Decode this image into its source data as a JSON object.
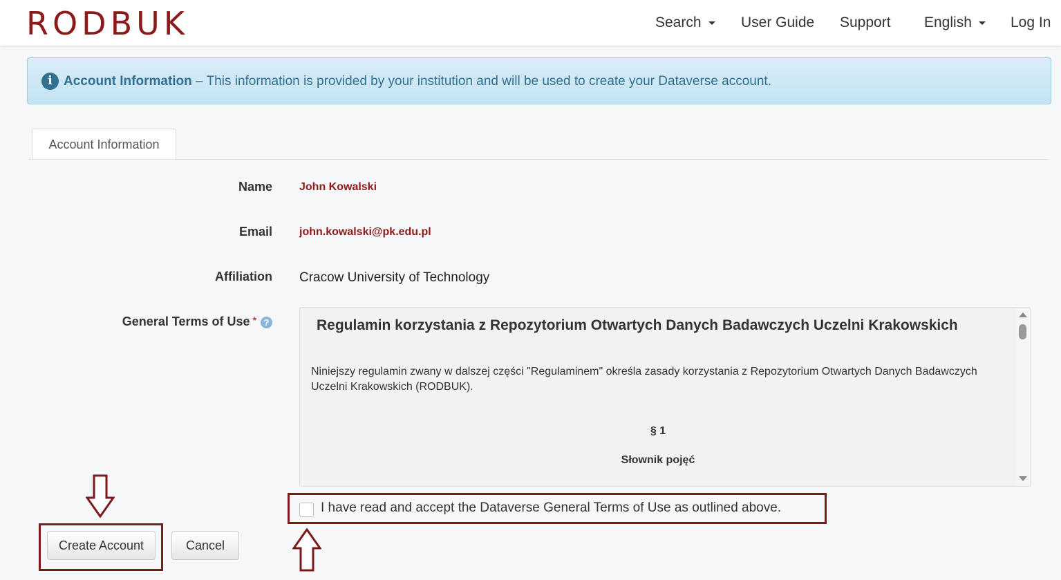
{
  "brand": {
    "logo_text": "RODBUK",
    "color": "#8b1a1a"
  },
  "nav": {
    "search": "Search",
    "user_guide": "User Guide",
    "support": "Support",
    "language": "English",
    "login": "Log In"
  },
  "alert": {
    "icon": "info-icon",
    "title": "Account Information",
    "message": " – This information is provided by your institution and will be used to create your Dataverse account."
  },
  "tabs": [
    {
      "label": "Account Information"
    }
  ],
  "form": {
    "name": {
      "label": "Name",
      "value": "John Kowalski"
    },
    "email": {
      "label": "Email",
      "value": "john.kowalski@pk.edu.pl"
    },
    "affiliation": {
      "label": "Affiliation",
      "value": "Cracow University of Technology"
    },
    "terms": {
      "label": "General Terms of Use",
      "required_mark": "*",
      "help_icon": "question-icon",
      "title": "Regulamin korzystania z Repozytorium Otwartych Danych Badawczych Uczelni Krakowskich",
      "paragraph": "Niniejszy regulamin zwany w dalszej części \"Regulaminem\" określa zasady korzystania z Repozytorium Otwartych Danych Badawczych Uczelni Krakowskich (RODBUK).",
      "section_number": "§ 1",
      "section_title": "Słownik pojęć"
    },
    "accept_label": "I have read and accept the Dataverse General Terms of Use as outlined above.",
    "accept_checked": false
  },
  "buttons": {
    "create": "Create Account",
    "cancel": "Cancel"
  },
  "annotation_color": "#7a1a1a"
}
